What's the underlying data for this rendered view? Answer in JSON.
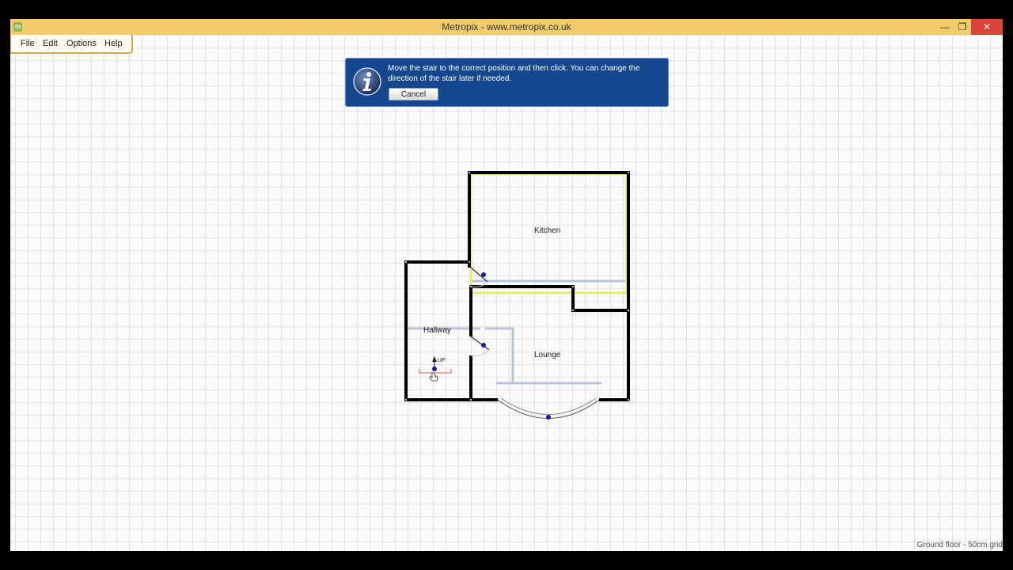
{
  "window": {
    "title": "Metropix - www.metropix.co.uk",
    "controls": {
      "minimize": "—",
      "restore": "❐",
      "close": "✕"
    }
  },
  "menu": {
    "file": "File",
    "edit": "Edit",
    "options": "Options",
    "help": "Help"
  },
  "banner": {
    "message": "Move the stair to the correct position and then click.  You can change the direction of the stair later if needed.",
    "cancel_label": "Cancel"
  },
  "rooms": {
    "kitchen": "Kitchen",
    "hallway": "Hallway",
    "lounge": "Lounge"
  },
  "stair": {
    "label": "UP"
  },
  "status": {
    "text": "Ground floor - 50cm grid"
  },
  "colors": {
    "titlebar": "#f2cc6b",
    "banner": "#14478e",
    "wall": "#000000",
    "selected_room": "#e6ec6e",
    "internal_wall": "#b8c4dc",
    "door_handle": "#1a1aa8",
    "stair_outline": "#e35a5a"
  }
}
